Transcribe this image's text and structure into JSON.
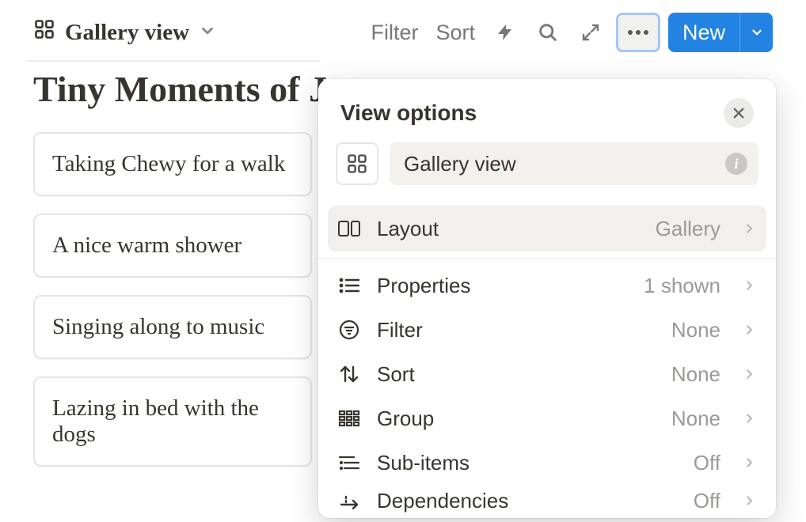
{
  "toolbar": {
    "view_label": "Gallery view",
    "filter_label": "Filter",
    "sort_label": "Sort",
    "new_label": "New"
  },
  "page": {
    "title": "Tiny Moments of Joy",
    "cards": [
      {
        "title": "Taking Chewy for a walk"
      },
      {
        "title": "A nice warm shower"
      },
      {
        "title": "Singing along to music"
      },
      {
        "title": "Lazing in bed with the dogs"
      }
    ]
  },
  "popover": {
    "title": "View options",
    "view_name": "Gallery view",
    "rows": [
      {
        "icon": "layout",
        "label": "Layout",
        "value": "Gallery",
        "highlight": true
      },
      {
        "icon": "list",
        "label": "Properties",
        "value": "1 shown"
      },
      {
        "icon": "filter",
        "label": "Filter",
        "value": "None"
      },
      {
        "icon": "sort",
        "label": "Sort",
        "value": "None"
      },
      {
        "icon": "group",
        "label": "Group",
        "value": "None"
      },
      {
        "icon": "subitems",
        "label": "Sub-items",
        "value": "Off"
      },
      {
        "icon": "deps",
        "label": "Dependencies",
        "value": "Off"
      }
    ]
  }
}
